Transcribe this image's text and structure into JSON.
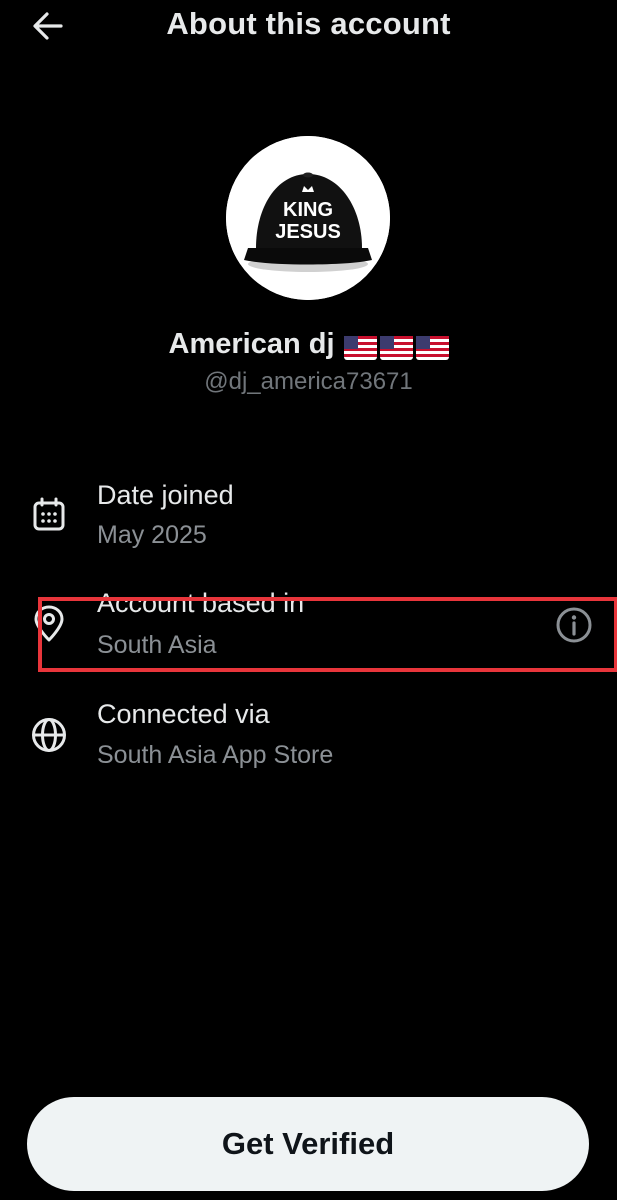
{
  "header": {
    "title": "About this account",
    "back_icon": "arrow-left-icon"
  },
  "profile": {
    "display_name": "American dj",
    "name_emoji": "🇺🇸🇺🇸🇺🇸",
    "handle": "@dj_america73671",
    "avatar": {
      "description_icon": "black-snapback-cap",
      "cap_text_line1": "KING",
      "cap_text_line2": "JESUS"
    }
  },
  "details": [
    {
      "label": "Date joined",
      "value": "May 2025",
      "icon": "calendar-icon"
    },
    {
      "label": "Account based in",
      "value": "South Asia",
      "icon": "location-pin-icon",
      "trailing_icon": "info-circle-icon"
    },
    {
      "label": "Connected via",
      "value": "South Asia App Store",
      "icon": "globe-icon"
    }
  ],
  "highlight": {
    "color": "#e8353b"
  },
  "cta": {
    "label": "Get Verified"
  },
  "colors": {
    "background": "#000000",
    "primary_text": "#e7e9ea",
    "secondary_text": "#8b9095",
    "button_bg": "#eff3f4",
    "button_text": "#0f1419"
  }
}
